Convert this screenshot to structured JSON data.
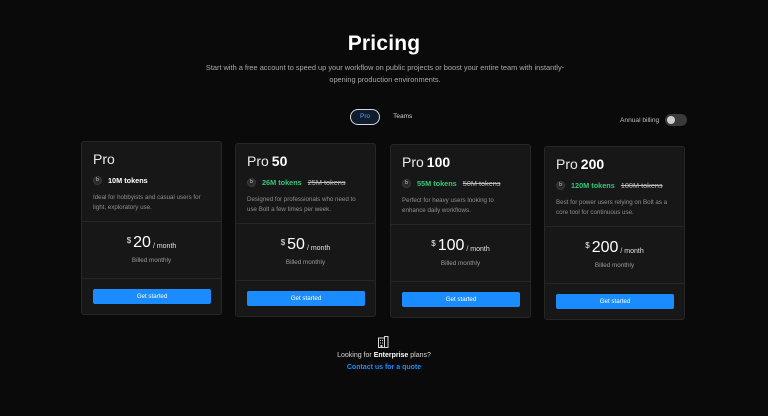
{
  "page": {
    "title": "Pricing",
    "subtitle": "Start with a free account to speed up your workflow on public projects or boost your entire team with instantly-opening production environments."
  },
  "tabs": [
    {
      "label": "Pro",
      "active": true
    },
    {
      "label": "Teams",
      "active": false
    }
  ],
  "billing": {
    "label": "Annual billing",
    "enabled": false
  },
  "plans": [
    {
      "name": "Pro",
      "tier": "",
      "tokens": "10M tokens",
      "old_tokens": "",
      "description": "Ideal for hobbyists and casual users for light, exploratory use.",
      "currency": "$",
      "price": "20",
      "period": "/ month",
      "billed": "Billed monthly",
      "cta": "Get started"
    },
    {
      "name": "Pro",
      "tier": "50",
      "tokens": "26M tokens",
      "old_tokens": "25M tokens",
      "description": "Designed for professionals who need to use Bolt a few times per week.",
      "currency": "$",
      "price": "50",
      "period": "/ month",
      "billed": "Billed monthly",
      "cta": "Get started"
    },
    {
      "name": "Pro",
      "tier": "100",
      "tokens": "55M tokens",
      "old_tokens": "50M tokens",
      "description": "Perfect for heavy users looking to enhance daily workflows.",
      "currency": "$",
      "price": "100",
      "period": "/ month",
      "billed": "Billed monthly",
      "cta": "Get started"
    },
    {
      "name": "Pro",
      "tier": "200",
      "tokens": "120M tokens",
      "old_tokens": "100M tokens",
      "description": "Best for power users relying on Bolt as a core tool for continuous use.",
      "currency": "$",
      "price": "200",
      "period": "/ month",
      "billed": "Billed monthly",
      "cta": "Get started"
    }
  ],
  "enterprise": {
    "prefix": "Looking for",
    "highlight": "Enterprise",
    "suffix": "plans?",
    "link": "Contact us for a quote",
    "icon": "building-icon"
  },
  "colors": {
    "background": "#0a0a0a",
    "card": "#171717",
    "accent": "#1a8cff",
    "green": "#34c77b"
  }
}
